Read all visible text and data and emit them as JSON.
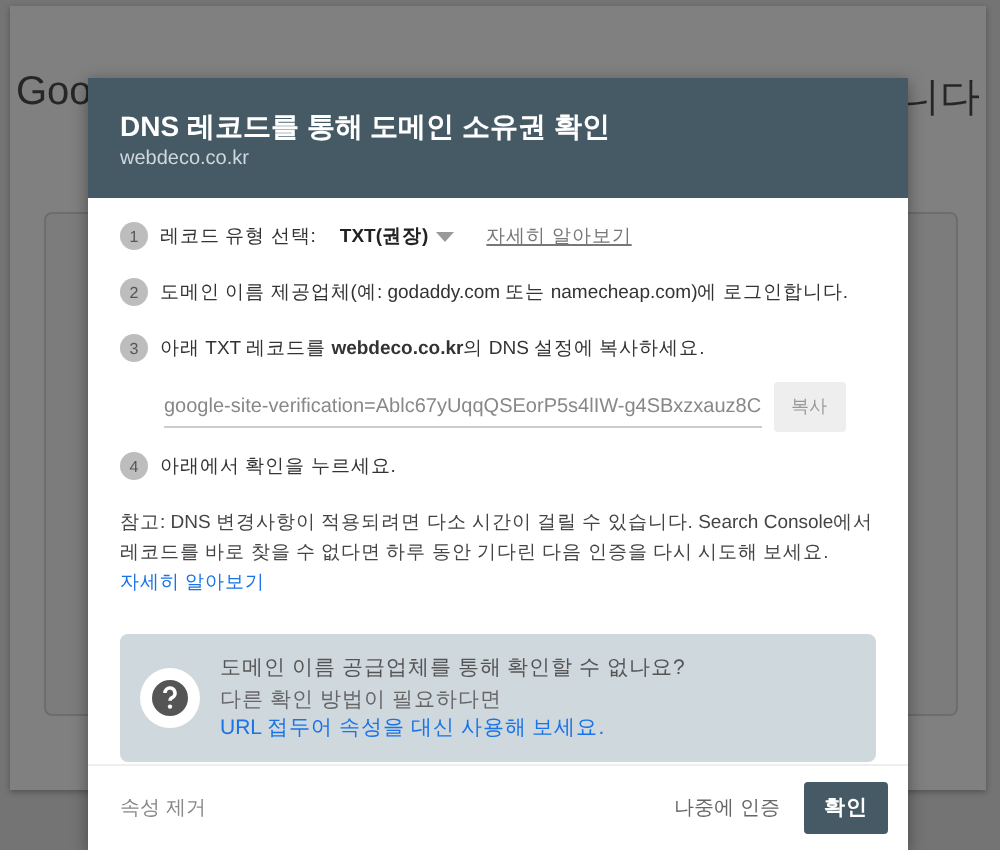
{
  "background": {
    "heading_start": "Goo",
    "heading_end": "니다"
  },
  "dialog": {
    "title": "DNS 레코드를 통해 도메인 소유권 확인",
    "subtitle": "webdeco.co.kr",
    "steps": [
      {
        "number": "1",
        "kind": "select",
        "text": "레코드 유형 선택:",
        "value": "TXT(권장)",
        "link": "자세히 알아보기"
      },
      {
        "number": "2",
        "kind": "text",
        "text": "도메인 이름 제공업체(예: godaddy.com 또는 namecheap.com)에 로그인합니다."
      },
      {
        "number": "3",
        "kind": "record",
        "text": "아래 TXT 레코드를 **webdeco.co.kr**의 DNS 설정에 복사하세요.",
        "record": "google-site-verification=Ablc67yUqqQSEorP5s4lIW-g4SBxzxauz8C",
        "button": "복사"
      },
      {
        "number": "4",
        "kind": "text",
        "text": "아래에서 확인을 누르세요."
      }
    ],
    "note": "참고: DNS 변경사항이 적용되려면 다소 시간이 걸릴 수 있습니다. Search Console에서 레코드를 바로 찾을 수 없다면 하루 동안 기다린 다음 인증을 다시 시도해 보세요.",
    "note_link": "자세히 알아보기",
    "help": {
      "title": "도메인 이름 공급업체를 통해 확인할 수 없나요?",
      "text": "다른 확인 방법이 필요하다면",
      "link": "URL 접두어 속성을 대신 사용해 보세요."
    },
    "footer": {
      "remove": "속성 제거",
      "later": "나중에 인증",
      "confirm": "확인"
    }
  }
}
